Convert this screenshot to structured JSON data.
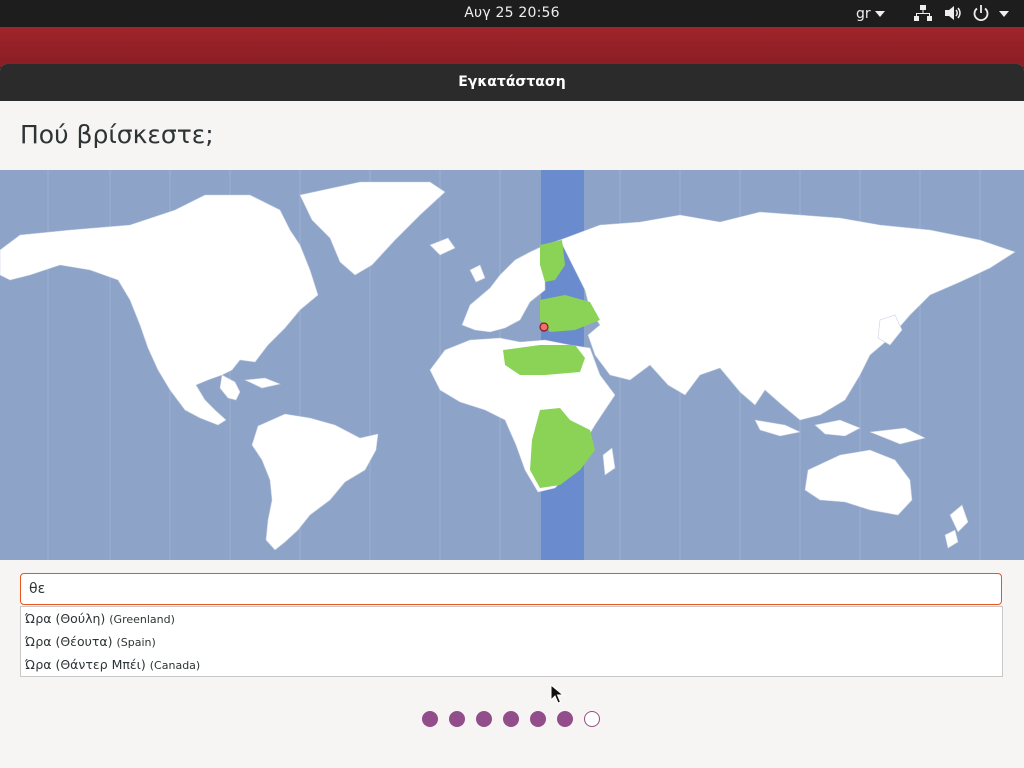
{
  "topbar": {
    "datetime": "Αυγ 25  20:56",
    "keyboard_layout": "gr",
    "icons": [
      "network-icon",
      "volume-icon",
      "power-icon",
      "chevron-down-icon"
    ]
  },
  "window": {
    "title": "Εγκατάσταση",
    "heading": "Πού βρίσκεστε;"
  },
  "search": {
    "value": "θε"
  },
  "suggestions": [
    {
      "label": "Ώρα (Θούλη)",
      "country": "(Greenland)"
    },
    {
      "label": "Ώρα (Θέουτα)",
      "country": "(Spain)"
    },
    {
      "label": "Ώρα (Θάντερ Μπέι)",
      "country": "(Canada)"
    }
  ],
  "progress": {
    "total_steps": 7,
    "completed_steps": 6
  },
  "colors": {
    "accent": "#e95420",
    "progress_dot": "#924d8b",
    "ocean": "#8da3c8",
    "selected_timezone_band": "#6a8ccf",
    "selected_zone_land": "#8bd357",
    "land": "#ffffff",
    "desktop_red": "#a0242b"
  }
}
